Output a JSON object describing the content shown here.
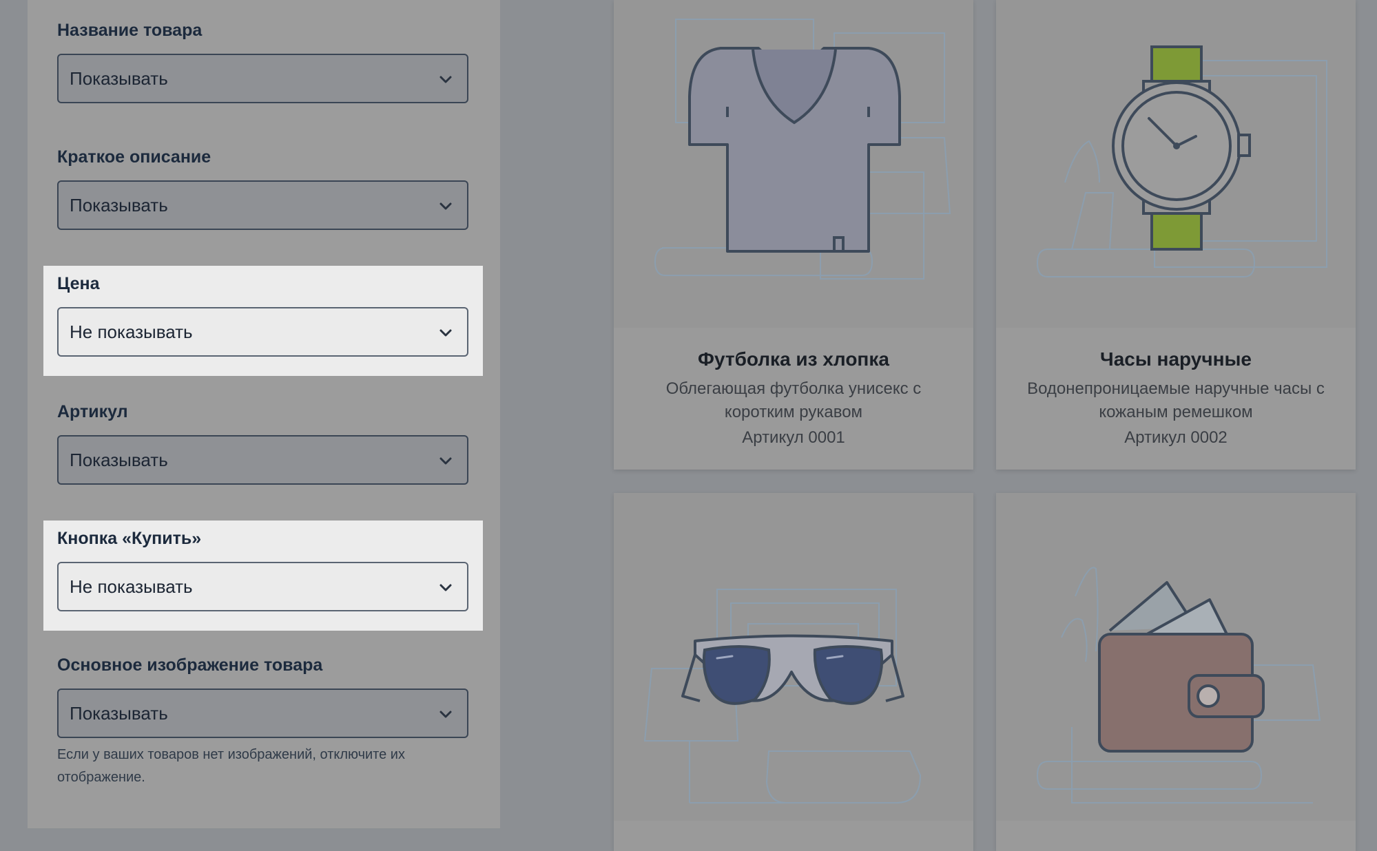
{
  "settings": {
    "fields": [
      {
        "label": "Название товара",
        "value": "Показывать"
      },
      {
        "label": "Краткое описание",
        "value": "Показывать"
      },
      {
        "label": "Цена",
        "value": "Не показывать"
      },
      {
        "label": "Артикул",
        "value": "Показывать"
      },
      {
        "label": "Кнопка «Купить»",
        "value": "Не показывать"
      },
      {
        "label": "Основное изображение товара",
        "value": "Показывать"
      }
    ],
    "image_hint": "Если у ваших товаров нет изображений, отключите их отображение."
  },
  "products": [
    {
      "title": "Футболка из хлопка",
      "description": "Облегающая футболка унисекс с коротким рукавом",
      "sku": "Артикул 0001",
      "icon": "tshirt-icon"
    },
    {
      "title": "Часы наручные",
      "description": "Водонепроницаемые наручные часы с кожаным ремешком",
      "sku": "Артикул 0002",
      "icon": "watch-icon"
    },
    {
      "title": "",
      "description": "",
      "sku": "",
      "icon": "sunglasses-icon"
    },
    {
      "title": "",
      "description": "",
      "sku": "",
      "icon": "wallet-icon"
    }
  ],
  "colors": {
    "background_dim": "#8c8f93",
    "highlight": "#ececec",
    "watch_strap": "#7e9a36",
    "sunglasses_lens": "#3f4e74",
    "wallet": "#87706d"
  }
}
